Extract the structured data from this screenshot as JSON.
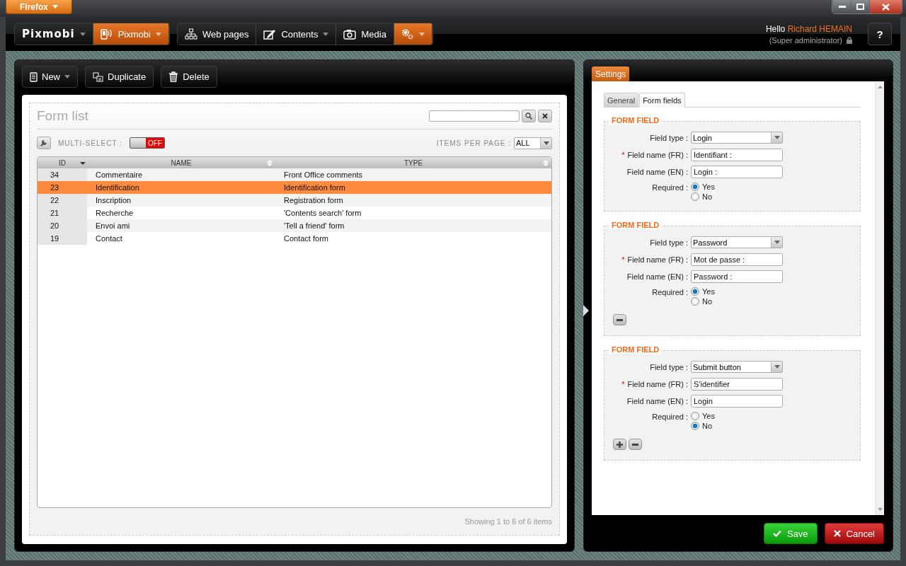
{
  "browser": {
    "menu_button": "Firefox"
  },
  "nav": {
    "groups": [
      [
        {
          "kind": "logo",
          "label": "Pixmobi",
          "highlighted": false,
          "dropdown": true
        },
        {
          "kind": "site",
          "label": "Pixmobi",
          "highlighted": true,
          "dropdown": true
        }
      ],
      [
        {
          "kind": "pages",
          "label": "Web pages",
          "highlighted": false,
          "dropdown": false
        },
        {
          "kind": "contents",
          "label": "Contents",
          "highlighted": false,
          "dropdown": true
        },
        {
          "kind": "media",
          "label": "Media",
          "highlighted": false,
          "dropdown": false
        },
        {
          "kind": "settings",
          "highlighted": true,
          "dropdown": true
        }
      ]
    ],
    "user": {
      "greeting": "Hello",
      "name": "Richard HEMAIN",
      "role": "(Super administrator)"
    },
    "help_button": "?"
  },
  "toolbar": [
    {
      "kind": "new",
      "label": "New",
      "dropdown": true
    },
    {
      "kind": "duplicate",
      "label": "Duplicate",
      "dropdown": false
    },
    {
      "kind": "delete",
      "label": "Delete",
      "dropdown": false
    }
  ],
  "form_list": {
    "title": "Form list",
    "multi_select": {
      "label": "MULTI-SELECT :",
      "on": false,
      "state_text": "OFF"
    },
    "items_per_page": {
      "label": "ITEMS PER PAGE :",
      "value": "ALL"
    },
    "table": {
      "columns": [
        {
          "label": "ID",
          "sorted": true
        },
        {
          "label": "NAME",
          "sorted": false
        },
        {
          "label": "TYPE",
          "sorted": false
        }
      ],
      "rows": [
        {
          "cells": [
            "34",
            "Commentaire",
            "Front Office comments"
          ],
          "selected": false
        },
        {
          "cells": [
            "23",
            "Identification",
            "Identification form"
          ],
          "selected": true
        },
        {
          "cells": [
            "22",
            "Inscription",
            "Registration form"
          ],
          "selected": false
        },
        {
          "cells": [
            "21",
            "Recherche",
            "'Contents search' form"
          ],
          "selected": false
        },
        {
          "cells": [
            "20",
            "Envoi ami",
            "'Tell a friend' form"
          ],
          "selected": false
        },
        {
          "cells": [
            "19",
            "Contact",
            "Contact form"
          ],
          "selected": false
        }
      ]
    },
    "footer": "Showing 1 to 6 of 6 items"
  },
  "settings": {
    "tab": "Settings",
    "tabs": [
      {
        "label": "General",
        "selected": false
      },
      {
        "label": "Form fields",
        "selected": true
      }
    ],
    "required_mark": "*",
    "fields": [
      {
        "title": "FORM FIELD",
        "type_label": "Field type :",
        "type": "Login",
        "fr_label": "Field name (FR) :",
        "fr_value": "Identifiant :",
        "en_label": "Field name (EN) :",
        "en_value": "Login :",
        "required_label": "Required :",
        "options": [
          {
            "label": "Yes",
            "selected": true
          },
          {
            "label": "No",
            "selected": false
          }
        ]
      },
      {
        "title": "FORM FIELD",
        "type_label": "Field type :",
        "type": "Password",
        "fr_label": "Field name (FR) :",
        "fr_value": "Mot de passe :",
        "en_label": "Field name (EN) :",
        "en_value": "Password :",
        "required_label": "Required :",
        "options": [
          {
            "label": "Yes",
            "selected": true
          },
          {
            "label": "No",
            "selected": false
          }
        ],
        "actions": [
          {
            "kind": "remove"
          }
        ]
      },
      {
        "title": "FORM FIELD",
        "type_label": "Field type :",
        "type": "Submit button",
        "fr_label": "Field name (FR) :",
        "fr_value": "S'identifier",
        "en_label": "Field name (EN) :",
        "en_value": "Login",
        "required_label": "Required :",
        "options": [
          {
            "label": "Yes",
            "selected": false
          },
          {
            "label": "No",
            "selected": true
          }
        ],
        "actions": [
          {
            "kind": "add"
          },
          {
            "kind": "remove"
          }
        ]
      }
    ],
    "buttons": [
      {
        "kind": "save",
        "label": "Save"
      },
      {
        "kind": "cancel",
        "label": "Cancel"
      }
    ]
  }
}
